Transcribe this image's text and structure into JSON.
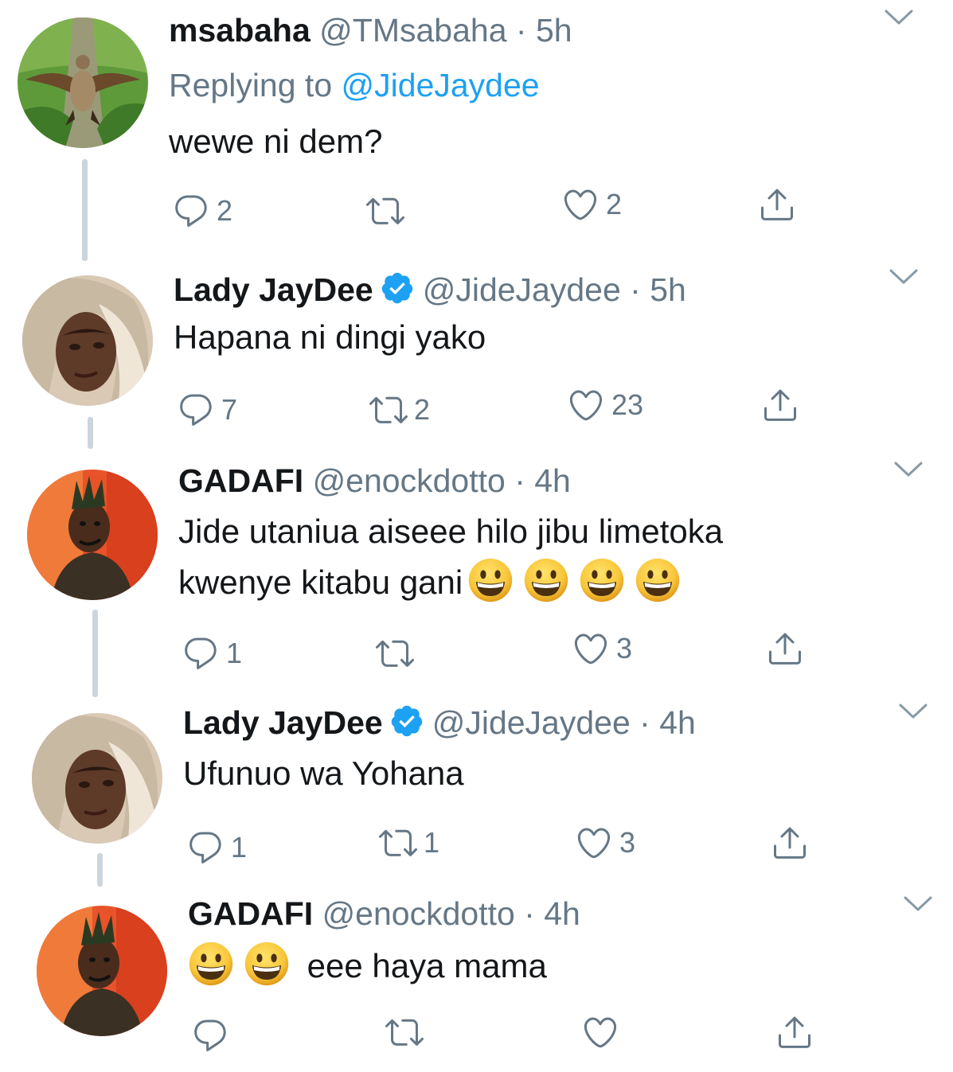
{
  "tweets": [
    {
      "name": "msabaha",
      "handle": "@TMsabaha",
      "dot": "·",
      "time": "5h",
      "verified": false,
      "replying_prefix": "Replying to",
      "replying_mention": "@JideJaydee",
      "text": "wewe ni dem?",
      "emoji_after": 0,
      "emoji_before": 0,
      "reply_count": "2",
      "retweet_count": "",
      "like_count": "2"
    },
    {
      "name": "Lady JayDee",
      "handle": "@JideJaydee",
      "dot": "·",
      "time": "5h",
      "verified": true,
      "text": "Hapana ni dingi yako",
      "reply_count": "7",
      "retweet_count": "2",
      "like_count": "23"
    },
    {
      "name": "GADAFI",
      "handle": "@enockdotto",
      "dot": "·",
      "time": "4h",
      "verified": false,
      "text_line1": "Jide utaniua aiseee hilo jibu limetoka",
      "text_line2": "kwenye kitabu gani",
      "emoji": "grinning-face",
      "reply_count": "1",
      "retweet_count": "",
      "like_count": "3"
    },
    {
      "name": "Lady JayDee",
      "handle": "@JideJaydee",
      "dot": "·",
      "time": "4h",
      "verified": true,
      "text": "Ufunuo wa Yohana",
      "reply_count": "1",
      "retweet_count": "1",
      "like_count": "3"
    },
    {
      "name": "GADAFI",
      "handle": "@enockdotto",
      "dot": "·",
      "time": "4h",
      "verified": false,
      "text": "eee haya mama",
      "emoji": "grinning-face",
      "reply_count": "",
      "retweet_count": "",
      "like_count": ""
    }
  ],
  "icons": {
    "reply": "reply-icon",
    "retweet": "retweet-icon",
    "like": "heart-icon",
    "share": "share-icon",
    "more": "chevron-down-icon",
    "verified": "verified-badge-icon"
  },
  "colors": {
    "text": "#14171a",
    "muted": "#657786",
    "link": "#1da1f2",
    "thread_line": "#cdd5dc"
  }
}
